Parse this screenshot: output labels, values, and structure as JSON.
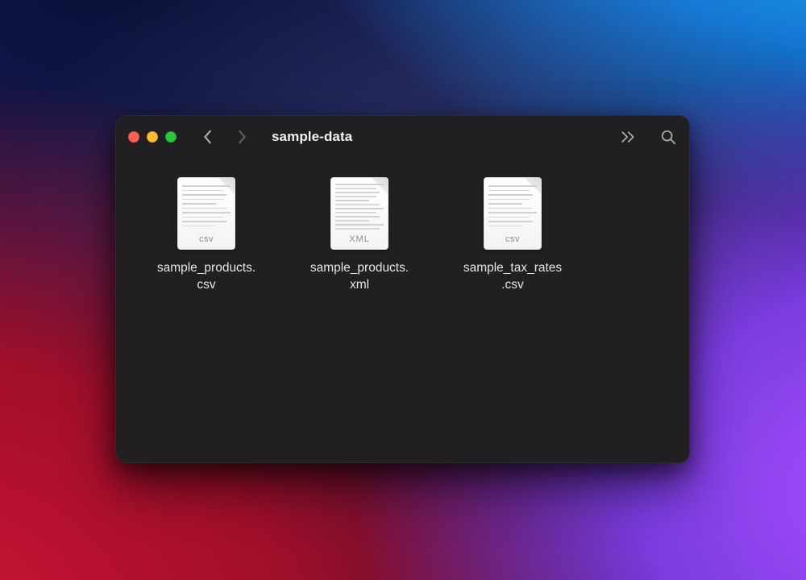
{
  "window": {
    "title": "sample-data"
  },
  "files": [
    {
      "name_line1": "sample_products.",
      "name_line2": "csv",
      "badge": "csv",
      "icon_type": "csv"
    },
    {
      "name_line1": "sample_products.",
      "name_line2": "xml",
      "badge": "XML",
      "icon_type": "xml"
    },
    {
      "name_line1": "sample_tax_rates",
      "name_line2": ".csv",
      "badge": "csv",
      "icon_type": "csv"
    }
  ]
}
